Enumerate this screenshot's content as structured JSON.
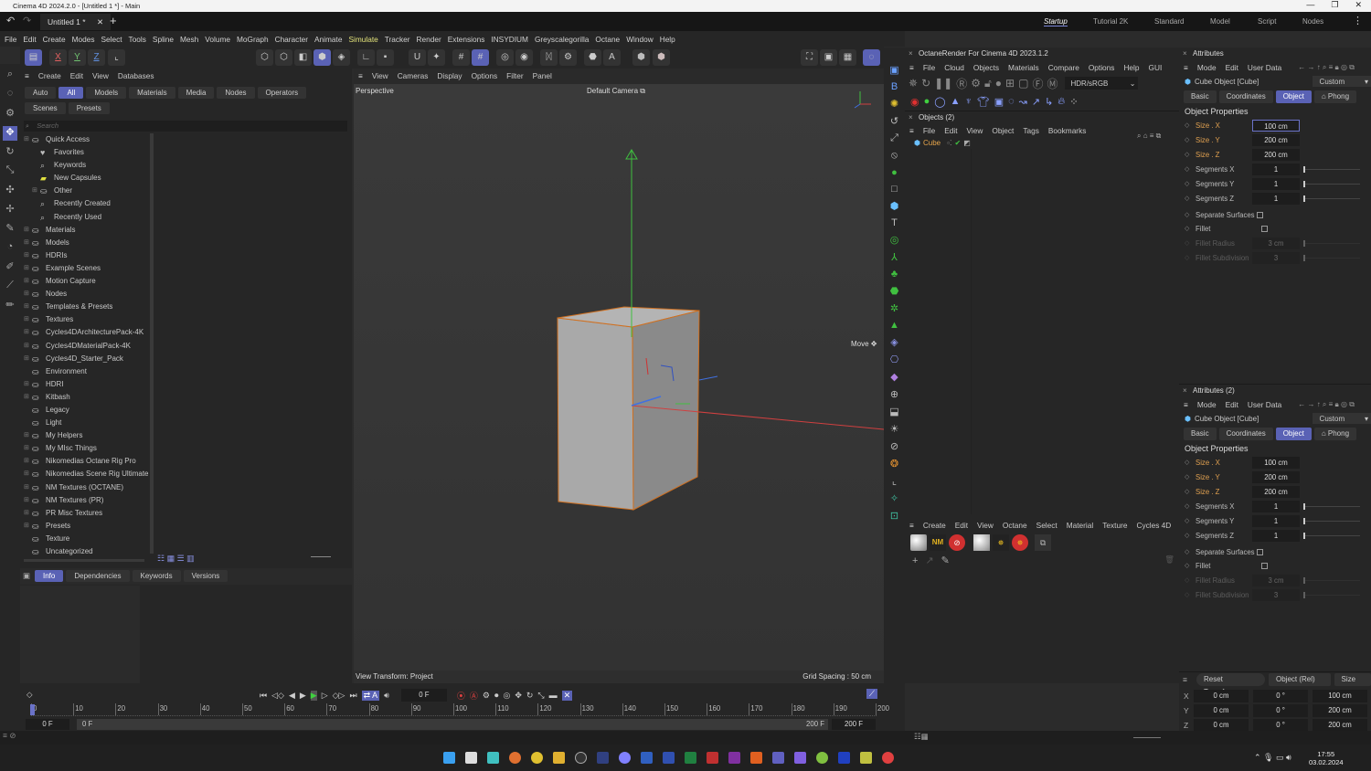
{
  "window": {
    "title": "Cinema 4D 2024.2.0 - [Untitled 1 *] - Main",
    "controls": [
      "—",
      "❐",
      "✕"
    ]
  },
  "doc_tab": {
    "label": "Untitled 1 *",
    "close": "✕",
    "new": "+"
  },
  "layouts": [
    {
      "label": "Startup",
      "active": true
    },
    {
      "label": "Tutorial 2K"
    },
    {
      "label": "Standard"
    },
    {
      "label": "Model"
    },
    {
      "label": "Script"
    },
    {
      "label": "Nodes"
    }
  ],
  "menu": [
    "File",
    "Edit",
    "Create",
    "Modes",
    "Select",
    "Tools",
    "Spline",
    "Mesh",
    "Volume",
    "MoGraph",
    "Character",
    "Animate",
    "Simulate",
    "Tracker",
    "Render",
    "Extensions",
    "INSYDIUM",
    "Greyscalegorilla",
    "Octane",
    "Window",
    "Help"
  ],
  "menu_highlight": "Simulate",
  "axis_buttons": [
    "X",
    "Y",
    "Z"
  ],
  "asset_browser": {
    "menu": [
      "Create",
      "Edit",
      "View",
      "Databases"
    ],
    "filters": [
      "Auto",
      "All",
      "Models",
      "Materials",
      "Media",
      "Nodes",
      "Operators",
      "Scenes",
      "Presets"
    ],
    "active_filter": "All",
    "search_placeholder": "Search",
    "tree": [
      {
        "label": "Quick Access",
        "level": 0,
        "icon": "folder"
      },
      {
        "label": "Favorites",
        "level": 1,
        "icon": "heart"
      },
      {
        "label": "Keywords",
        "level": 1,
        "icon": "search"
      },
      {
        "label": "New Capsules",
        "level": 1,
        "icon": "capsule"
      },
      {
        "label": "Other",
        "level": 1,
        "icon": "folder"
      },
      {
        "label": "Recently Created",
        "level": 1,
        "icon": "search"
      },
      {
        "label": "Recently Used",
        "level": 1,
        "icon": "search"
      },
      {
        "label": "Materials",
        "level": 0,
        "icon": "folder"
      },
      {
        "label": "Models",
        "level": 0,
        "icon": "folder"
      },
      {
        "label": "HDRIs",
        "level": 0,
        "icon": "folder"
      },
      {
        "label": "Example Scenes",
        "level": 0,
        "icon": "folder"
      },
      {
        "label": "Motion Capture",
        "level": 0,
        "icon": "folder"
      },
      {
        "label": "Nodes",
        "level": 0,
        "icon": "folder"
      },
      {
        "label": "Templates & Presets",
        "level": 0,
        "icon": "folder"
      },
      {
        "label": "Textures",
        "level": 0,
        "icon": "folder"
      },
      {
        "label": "Cycles4DArchitecturePack-4K",
        "level": 0,
        "icon": "folder"
      },
      {
        "label": "Cycles4DMaterialPack-4K",
        "level": 0,
        "icon": "folder"
      },
      {
        "label": "Cycles4D_Starter_Pack",
        "level": 0,
        "icon": "folder"
      },
      {
        "label": "Environment",
        "level": 0,
        "icon": "folder"
      },
      {
        "label": "HDRI",
        "level": 0,
        "icon": "folder"
      },
      {
        "label": "Kitbash",
        "level": 0,
        "icon": "folder"
      },
      {
        "label": "Legacy",
        "level": 0,
        "icon": "folder"
      },
      {
        "label": "Light",
        "level": 0,
        "icon": "folder"
      },
      {
        "label": "My Helpers",
        "level": 0,
        "icon": "folder"
      },
      {
        "label": "My MIsc Things",
        "level": 0,
        "icon": "folder"
      },
      {
        "label": "Nikomedias Octane Rig Pro",
        "level": 0,
        "icon": "folder"
      },
      {
        "label": "Nikomedias Scene Rig Ultimate",
        "level": 0,
        "icon": "folder"
      },
      {
        "label": "NM Textures (OCTANE)",
        "level": 0,
        "icon": "folder"
      },
      {
        "label": "NM Textures (PR)",
        "level": 0,
        "icon": "folder"
      },
      {
        "label": "PR Misc Textures",
        "level": 0,
        "icon": "folder"
      },
      {
        "label": "Presets",
        "level": 0,
        "icon": "folder"
      },
      {
        "label": "Texture",
        "level": 0,
        "icon": "folder"
      },
      {
        "label": "Uncategorized",
        "level": 0,
        "icon": "folder"
      }
    ],
    "info_tabs": [
      "Info",
      "Dependencies",
      "Keywords",
      "Versions"
    ],
    "active_info_tab": "Info"
  },
  "viewport": {
    "menu": [
      "View",
      "Cameras",
      "Display",
      "Options",
      "Filter",
      "Panel"
    ],
    "projection": "Perspective",
    "camera": "Default Camera",
    "tool_hint": "Move",
    "view_transform": "View Transform: Project",
    "grid_spacing": "Grid Spacing : 50 cm"
  },
  "octane": {
    "title": "OctaneRender For Cinema 4D 2023.1.2",
    "menu": [
      "File",
      "Cloud",
      "Objects",
      "Materials",
      "Compare",
      "Options",
      "Help",
      "GUI"
    ],
    "color_mode": "HDR/sRGB"
  },
  "objects": {
    "title": "Objects (2)",
    "menu": [
      "File",
      "Edit",
      "View",
      "Object",
      "Tags",
      "Bookmarks"
    ],
    "items": [
      {
        "name": "Cube"
      }
    ]
  },
  "materials": {
    "menu": [
      "Create",
      "Edit",
      "View",
      "Octane",
      "Select",
      "Material",
      "Texture",
      "Cycles 4D"
    ]
  },
  "attributes": [
    {
      "title": "Attributes",
      "menu": [
        "Mode",
        "Edit",
        "User Data"
      ],
      "object": "Cube Object [Cube]",
      "preset": "Custom",
      "tabs": [
        "Basic",
        "Coordinates",
        "Object",
        "Phong"
      ],
      "active_tab": "Object",
      "section": "Object Properties",
      "size": [
        {
          "label": "Size . X",
          "value": "100 cm"
        },
        {
          "label": "Size . Y",
          "value": "200 cm"
        },
        {
          "label": "Size . Z",
          "value": "200 cm"
        }
      ],
      "segments": [
        {
          "label": "Segments X",
          "value": "1"
        },
        {
          "label": "Segments Y",
          "value": "1"
        },
        {
          "label": "Segments Z",
          "value": "1"
        }
      ],
      "separate_surfaces": "Separate Surfaces",
      "fillet": "Fillet",
      "fillet_radius": {
        "label": "Fillet Radius",
        "value": "3 cm"
      },
      "fillet_subdivision": {
        "label": "Fillet Subdivision",
        "value": "3"
      }
    },
    {
      "title": "Attributes (2)",
      "menu": [
        "Mode",
        "Edit",
        "User Data"
      ],
      "object": "Cube Object [Cube]",
      "preset": "Custom",
      "tabs": [
        "Basic",
        "Coordinates",
        "Object",
        "Phong"
      ],
      "active_tab": "Object",
      "section": "Object Properties",
      "size": [
        {
          "label": "Size . X",
          "value": "100 cm"
        },
        {
          "label": "Size . Y",
          "value": "200 cm"
        },
        {
          "label": "Size . Z",
          "value": "200 cm"
        }
      ],
      "segments": [
        {
          "label": "Segments X",
          "value": "1"
        },
        {
          "label": "Segments Y",
          "value": "1"
        },
        {
          "label": "Segments Z",
          "value": "1"
        }
      ],
      "separate_surfaces": "Separate Surfaces",
      "fillet": "Fillet",
      "fillet_radius": {
        "label": "Fillet Radius",
        "value": "3 cm"
      },
      "fillet_subdivision": {
        "label": "Fillet Subdivision",
        "value": "3"
      }
    }
  ],
  "coordinates": {
    "reset": "Reset Transform",
    "mode": "Object (Rel)",
    "size_mode": "Size",
    "rows": [
      {
        "axis": "X",
        "pos": "0 cm",
        "rot": "0 °",
        "size": "100 cm"
      },
      {
        "axis": "Y",
        "pos": "0 cm",
        "rot": "0 °",
        "size": "200 cm"
      },
      {
        "axis": "Z",
        "pos": "0 cm",
        "rot": "0 °",
        "size": "200 cm"
      }
    ]
  },
  "timeline": {
    "current_frame": "0 F",
    "ticks": [
      "0",
      "10",
      "20",
      "30",
      "40",
      "50",
      "60",
      "70",
      "80",
      "90",
      "100",
      "110",
      "120",
      "130",
      "140",
      "150",
      "160",
      "170",
      "180",
      "190",
      "200"
    ],
    "start": "0 F",
    "range_start": "0 F",
    "range_end": "200 F",
    "end": "200 F"
  },
  "taskbar": {
    "time": "17:55",
    "date": "03.02.2024"
  }
}
